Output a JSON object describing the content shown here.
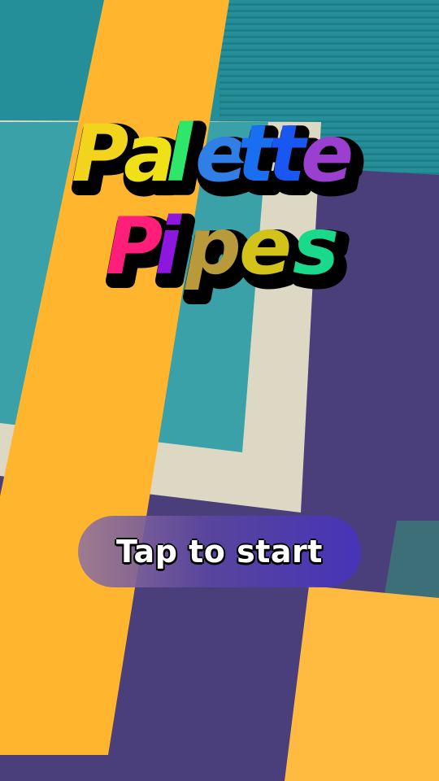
{
  "title": {
    "line1": [
      "P",
      "a",
      "l",
      "e",
      "t",
      "t",
      "e"
    ],
    "line2": [
      "P",
      "i",
      "p",
      "e",
      "s"
    ],
    "line1_colors": [
      "#f3d41c",
      "#f0e018",
      "#2ee66a",
      "#2f7fe6",
      "#1a6ff0",
      "#1a56f2",
      "#9a3fcf"
    ],
    "line2_colors": [
      "#ff1f7a",
      "#8e17e0",
      "#b89a3a",
      "#d2c21a",
      "#19d98a"
    ]
  },
  "start": {
    "label": "Tap to start"
  },
  "colors": {
    "purple_paper": "#4a3f7a",
    "teal_paper": "#2f9ea6",
    "teal_stripes": "#248f98",
    "orange_paper": "#ffb62e",
    "cream_paper": "#ddd8c4",
    "light_teal_paper": "#3aa1a9",
    "dark_teal_paper": "#3d6f78"
  }
}
